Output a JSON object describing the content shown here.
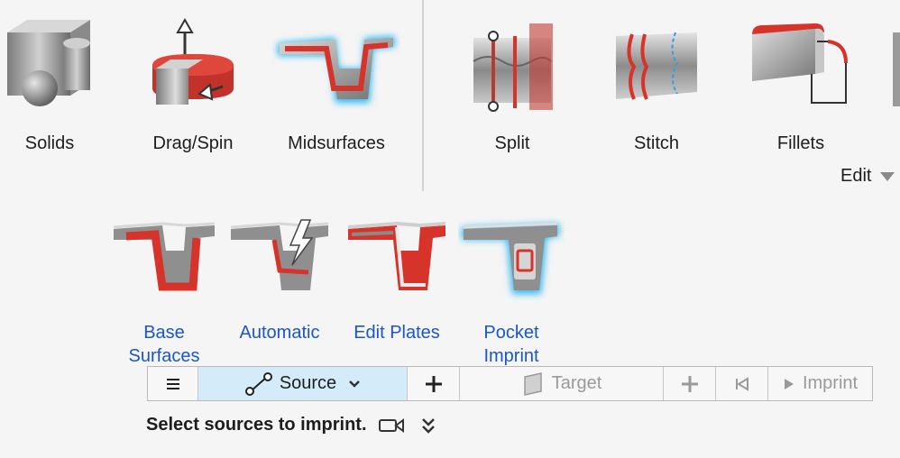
{
  "ribbon": {
    "tools": [
      {
        "label": "Solids",
        "icon": "solids-icon"
      },
      {
        "label": "Drag/Spin",
        "icon": "drag-spin-icon"
      },
      {
        "label": "Midsurfaces",
        "icon": "midsurfaces-icon",
        "active": true
      },
      {
        "label": "Split",
        "icon": "split-icon"
      },
      {
        "label": "Stitch",
        "icon": "stitch-icon"
      },
      {
        "label": "Fillets",
        "icon": "fillets-icon"
      }
    ],
    "edit_label": "Edit"
  },
  "midsurface_tools": [
    {
      "label_line1": "Base",
      "label_line2": "Surfaces",
      "icon": "base-surfaces-icon"
    },
    {
      "label_line1": "Automatic",
      "label_line2": "",
      "icon": "automatic-icon"
    },
    {
      "label_line1": "Edit Plates",
      "label_line2": "",
      "icon": "edit-plates-icon"
    },
    {
      "label_line1": "Pocket",
      "label_line2": "Imprint",
      "icon": "pocket-imprint-icon",
      "active": true
    }
  ],
  "guide_bar": {
    "menu_icon": "hamburger-icon",
    "source_label": "Source",
    "target_label": "Target",
    "imprint_label": "Imprint"
  },
  "status": {
    "message": "Select sources to imprint."
  },
  "colors": {
    "accent_blue": "#1a56c8",
    "active_glow": "#2fb6f0",
    "source_bg": "#d4ecf9",
    "red": "#d6342b"
  }
}
